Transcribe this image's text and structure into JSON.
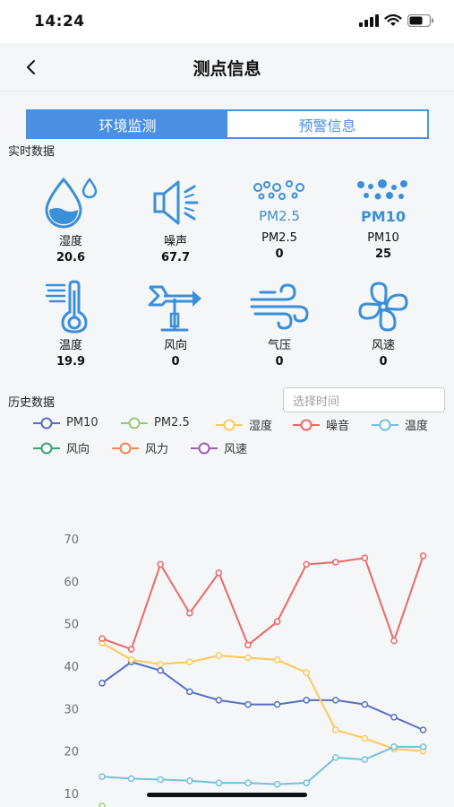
{
  "status_bar": {
    "time": "14:24"
  },
  "nav": {
    "title": "测点信息"
  },
  "tabs": [
    {
      "label": "环境监测",
      "active": true
    },
    {
      "label": "预警信息",
      "active": false
    }
  ],
  "realtime": {
    "title": "实时数据",
    "metrics": [
      {
        "label": "湿度",
        "value": "20.6",
        "icon": "water-drop-icon",
        "icon_text": ""
      },
      {
        "label": "噪声",
        "value": "67.7",
        "icon": "speaker-icon",
        "icon_text": ""
      },
      {
        "label": "PM2.5",
        "value": "0",
        "icon": "pm25-icon",
        "icon_text": "PM2.5"
      },
      {
        "label": "PM10",
        "value": "25",
        "icon": "pm10-icon",
        "icon_text": "PM10"
      },
      {
        "label": "温度",
        "value": "19.9",
        "icon": "thermometer-icon",
        "icon_text": ""
      },
      {
        "label": "风向",
        "value": "0",
        "icon": "wind-vane-icon",
        "icon_text": ""
      },
      {
        "label": "气压",
        "value": "0",
        "icon": "wind-icon",
        "icon_text": ""
      },
      {
        "label": "风速",
        "value": "0",
        "icon": "fan-icon",
        "icon_text": ""
      }
    ]
  },
  "history": {
    "title": "历史数据",
    "time_placeholder": "选择时间"
  },
  "colors": {
    "accent": "#4a90e2",
    "icon": "#3a8fd9"
  },
  "chart_data": {
    "type": "line",
    "title": "",
    "xlabel": "",
    "ylabel": "",
    "ylim": [
      10,
      70
    ],
    "y_ticks": [
      10,
      20,
      30,
      40,
      50,
      60,
      70
    ],
    "grid": false,
    "legend_position": "top",
    "x": [
      1,
      2,
      3,
      4,
      5,
      6,
      7,
      8,
      9,
      10,
      11,
      12,
      13,
      14
    ],
    "series": [
      {
        "name": "PM10",
        "color": "#5470c6",
        "values": [
          36,
          41,
          39,
          34,
          32,
          31,
          31,
          32,
          32,
          31,
          28,
          25,
          null,
          null
        ]
      },
      {
        "name": "PM2.5",
        "color": "#91cc75",
        "values": [
          null,
          null,
          null,
          null,
          null,
          null,
          null,
          null,
          null,
          null,
          null,
          null,
          null,
          null
        ]
      },
      {
        "name": "湿度",
        "color": "#fac858",
        "values": [
          45.5,
          41.5,
          40.5,
          41,
          42.5,
          42,
          41.5,
          38.5,
          25,
          23,
          20.5,
          20,
          null,
          null
        ]
      },
      {
        "name": "噪音",
        "color": "#ee6666",
        "values": [
          46.5,
          44,
          64,
          52.5,
          62,
          45,
          50.5,
          64,
          64.5,
          65.5,
          46,
          66,
          null,
          null
        ]
      },
      {
        "name": "温度",
        "color": "#73c0de",
        "values": [
          14,
          13.5,
          13.3,
          13,
          12.5,
          12.5,
          12.2,
          12.5,
          18.5,
          18,
          21,
          21,
          null,
          null
        ]
      },
      {
        "name": "风向",
        "color": "#3ba272",
        "values": []
      },
      {
        "name": "风力",
        "color": "#fc8452",
        "values": []
      },
      {
        "name": "风速",
        "color": "#9a60b4",
        "values": []
      }
    ]
  }
}
